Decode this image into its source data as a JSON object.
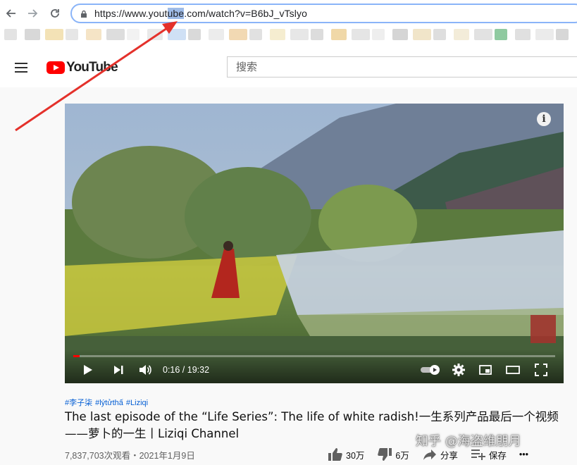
{
  "browser": {
    "url_prefix": "https://www.yout",
    "url_highlight": "ube",
    "url_suffix": ".com/watch?v=B6bJ_vTslyo",
    "bookmark_colors": [
      "#e3e3e3",
      "#d8d8d8",
      "#f3e2b6",
      "#e6e6e6",
      "#f5e4c6",
      "#dddddd",
      "#f2f2f2",
      "#e9e9e9",
      "#cfe0f5",
      "#d9d9d9",
      "#ececec",
      "#f2d9b3",
      "#e1e1e1",
      "#f5edd0",
      "#e7e7e7",
      "#dcdcdc",
      "#f0d8a8",
      "#e5e5e5",
      "#eeeeee",
      "#d5d5d5",
      "#f1e5c9",
      "#dedede",
      "#f3ecd9",
      "#e2e2e2",
      "#8fcaa0",
      "#e0e0e0",
      "#ebebeb",
      "#d7d7d7"
    ]
  },
  "header": {
    "logo_text": "YouTube",
    "search_placeholder": "搜索"
  },
  "player": {
    "info_glyph": "i",
    "time_display": "0:16 / 19:32",
    "progress_fraction": 0.0137
  },
  "video": {
    "tags": [
      "#李子柒",
      "#lýtửthấ",
      "#Liziqi"
    ],
    "title": "The last episode of the “Life Series”: The life of white radish!一生系列产品最后一个视频——萝卜的一生丨Liziqi Channel",
    "views_date": "7,837,703次观看・2021年1月9日",
    "likes": "30万",
    "dislikes": "6万",
    "share_label": "分享",
    "save_label": "保存",
    "more_label": "•••"
  },
  "watermark": "知乎 @海盗维朋月"
}
